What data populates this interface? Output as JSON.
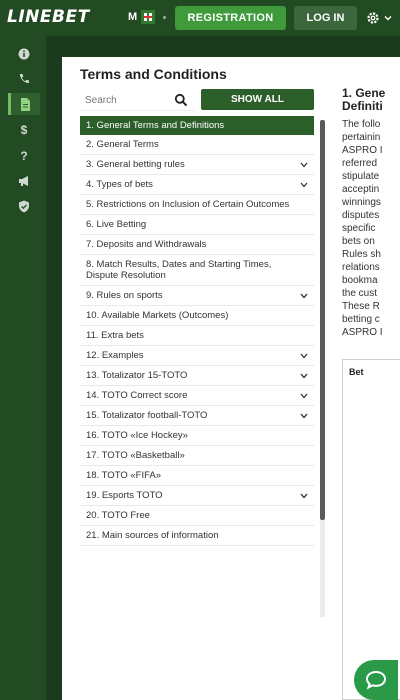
{
  "header": {
    "logo": "LINEBET",
    "lang": "M",
    "registration_label": "REGISTRATION",
    "login_label": "LOG IN",
    "settings_icon": "gear-icon"
  },
  "sidebar": {
    "icons": [
      "info-icon",
      "phone-icon",
      "document-icon",
      "dollar-icon",
      "question-icon",
      "megaphone-icon",
      "shield-icon"
    ],
    "active": "document-icon"
  },
  "panel": {
    "title": "Terms and Conditions",
    "search_placeholder": "Search",
    "show_all_label": "SHOW ALL"
  },
  "items": [
    {
      "label": "1. General Terms and Definitions",
      "active": true,
      "expand": false
    },
    {
      "label": "2. General Terms",
      "active": false,
      "expand": false
    },
    {
      "label": "3. General betting rules",
      "active": false,
      "expand": true
    },
    {
      "label": "4. Types of bets",
      "active": false,
      "expand": true
    },
    {
      "label": "5. Restrictions on Inclusion of Certain Outcomes",
      "active": false,
      "expand": false
    },
    {
      "label": "6. Live Betting",
      "active": false,
      "expand": false
    },
    {
      "label": "7. Deposits and Withdrawals",
      "active": false,
      "expand": false
    },
    {
      "label": "8. Match Results, Dates and Starting Times, Dispute Resolution",
      "active": false,
      "expand": false
    },
    {
      "label": "9. Rules on sports",
      "active": false,
      "expand": true
    },
    {
      "label": "10. Available Markets (Outcomes)",
      "active": false,
      "expand": false
    },
    {
      "label": "11. Extra bets",
      "active": false,
      "expand": false
    },
    {
      "label": "12. Examples",
      "active": false,
      "expand": true
    },
    {
      "label": "13. Totalizator 15-TOTO",
      "active": false,
      "expand": true
    },
    {
      "label": "14. TOTO Correct score",
      "active": false,
      "expand": true
    },
    {
      "label": "15. Totalizator football-TOTO",
      "active": false,
      "expand": true
    },
    {
      "label": "16. TOTO «Ice Hockey»",
      "active": false,
      "expand": false
    },
    {
      "label": "17. TOTO «Basketball»",
      "active": false,
      "expand": false
    },
    {
      "label": "18. TOTO «FIFA»",
      "active": false,
      "expand": false
    },
    {
      "label": "19. Esports TOTO",
      "active": false,
      "expand": true
    },
    {
      "label": "20. TOTO Free",
      "active": false,
      "expand": false
    },
    {
      "label": "21. Main sources of information",
      "active": false,
      "expand": false
    }
  ],
  "content": {
    "heading_line1": "1. Gene",
    "heading_line2": "Definiti",
    "lines": [
      "The follo",
      "pertainin",
      "ASPRO I",
      "referred",
      "stipulate",
      "acceptin",
      "winnings",
      "disputes",
      "specific",
      "bets on",
      "Rules sh",
      "relations",
      "bookma",
      "the cust",
      "These R",
      "betting c",
      "ASPRO I"
    ],
    "bet_label": "Bet"
  }
}
